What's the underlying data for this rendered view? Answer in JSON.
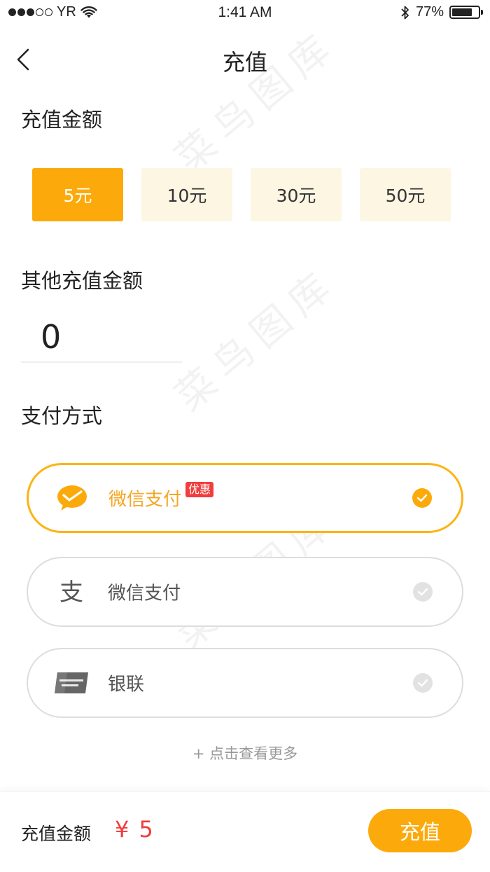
{
  "status_bar": {
    "carrier": "YR",
    "time": "1:41 AM",
    "battery_text": "77%",
    "battery_level": 0.77
  },
  "nav": {
    "title": "充值"
  },
  "recharge": {
    "section_title": "充值金额",
    "amounts": [
      {
        "label": "5元",
        "selected": true
      },
      {
        "label": "10元",
        "selected": false
      },
      {
        "label": "30元",
        "selected": false
      },
      {
        "label": "50元",
        "selected": false
      }
    ]
  },
  "other_amount": {
    "section_title": "其他充值金额",
    "value": "0"
  },
  "payment": {
    "section_title": "支付方式",
    "options": [
      {
        "label": "微信支付",
        "badge": "优惠",
        "selected": true,
        "icon": "wechat-pay-icon"
      },
      {
        "label": "微信支付",
        "selected": false,
        "icon": "alipay-icon"
      },
      {
        "label": "银联",
        "selected": false,
        "icon": "unionpay-icon"
      }
    ],
    "more": "+ 点击查看更多"
  },
  "bottom": {
    "label": "充值金额",
    "amount": "¥ 5",
    "submit": "充值"
  },
  "watermark": "菜鸟图库",
  "colors": {
    "accent": "#fcaa0b",
    "amount_bg": "#fdf6e3",
    "price_red": "#f23d3d",
    "border_gray": "#dddddd"
  }
}
